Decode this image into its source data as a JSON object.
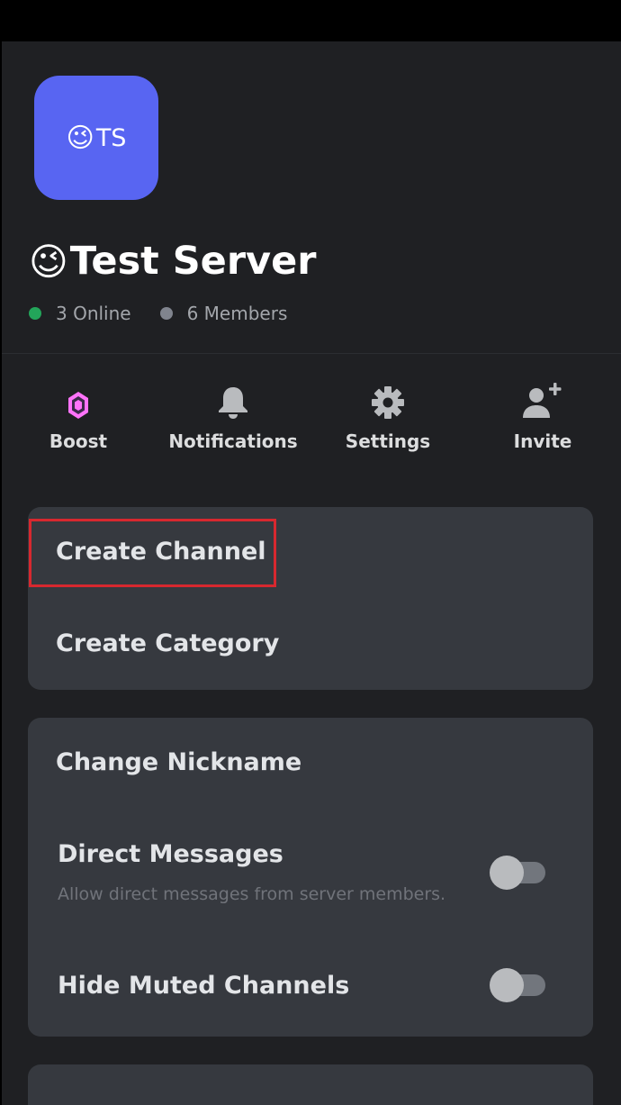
{
  "server": {
    "icon_emoji": "😉",
    "icon_initials": "TS",
    "name_emoji": "😉",
    "name": "Test Server",
    "online": "3 Online",
    "members": "6 Members"
  },
  "actions": [
    {
      "label": "Boost",
      "icon": "boost-gem-icon"
    },
    {
      "label": "Notifications",
      "icon": "bell-icon"
    },
    {
      "label": "Settings",
      "icon": "gear-icon"
    },
    {
      "label": "Invite",
      "icon": "add-person-icon"
    }
  ],
  "create_section": {
    "create_channel": "Create Channel",
    "create_category": "Create Category"
  },
  "settings_section": {
    "change_nickname": "Change Nickname",
    "direct_messages": {
      "label": "Direct Messages",
      "description": "Allow direct messages from server members.",
      "enabled": false
    },
    "hide_muted": {
      "label": "Hide Muted Channels",
      "enabled": false
    }
  },
  "colors": {
    "accent": "#5865f2",
    "online": "#23a55a",
    "members": "#80848e",
    "boost": "#ff73fa",
    "highlight": "#d7282f"
  }
}
